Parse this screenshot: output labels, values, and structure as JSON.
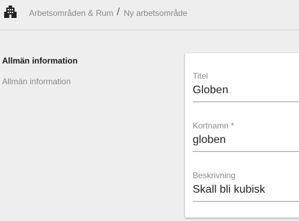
{
  "header": {
    "icon": "building-icon",
    "breadcrumb": {
      "parent": "Arbetsområden & Rum",
      "separator": "/",
      "current": "Ny arbetsområde"
    }
  },
  "section": {
    "title": "Allmän information",
    "subtitle": "Allmän information"
  },
  "form": {
    "fields": [
      {
        "label": "Titel",
        "value": "Globen"
      },
      {
        "label": "Kortnamn *",
        "value": "globen"
      },
      {
        "label": "Beskrivning",
        "value": "Skall bli kubisk"
      }
    ]
  }
}
